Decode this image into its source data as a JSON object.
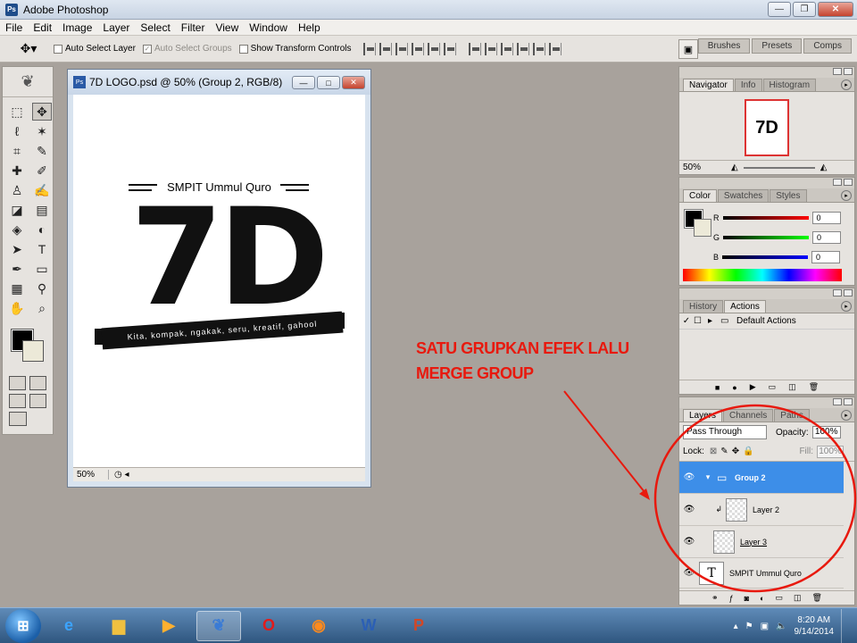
{
  "app": {
    "title": "Adobe Photoshop"
  },
  "menu": [
    "File",
    "Edit",
    "Image",
    "Layer",
    "Select",
    "Filter",
    "View",
    "Window",
    "Help"
  ],
  "options": {
    "auto_select_layer": "Auto Select Layer",
    "auto_select_groups": "Auto Select Groups",
    "show_transform_controls": "Show Transform Controls",
    "panel_tabs": [
      "Brushes",
      "Presets",
      "Comps"
    ]
  },
  "document": {
    "title": "7D LOGO.psd @ 50% (Group 2, RGB/8)",
    "zoom": "50%",
    "artwork": {
      "school": "SMPIT Ummul Quro",
      "logo": "7D",
      "banner": "Kita, kompak, ngakak, seru, kreatif, gahool"
    }
  },
  "navigator": {
    "tabs": [
      "Navigator",
      "Info",
      "Histogram"
    ],
    "zoom": "50%",
    "thumb_text": "7D"
  },
  "color": {
    "tabs": [
      "Color",
      "Swatches",
      "Styles"
    ],
    "channels": [
      {
        "label": "R",
        "value": "0",
        "color": "#cc1111"
      },
      {
        "label": "G",
        "value": "0",
        "color": "#119911"
      },
      {
        "label": "B",
        "value": "0",
        "color": "#1133cc"
      }
    ]
  },
  "history": {
    "tabs": [
      "History",
      "Actions"
    ],
    "items": [
      "Default Actions"
    ]
  },
  "layers": {
    "tabs": [
      "Layers",
      "Channels",
      "Paths"
    ],
    "blend_mode": "Pass Through",
    "opacity_label": "Opacity:",
    "opacity": "100%",
    "lock_label": "Lock:",
    "fill_label": "Fill:",
    "fill": "100%",
    "items": [
      {
        "name": "Group 2",
        "selected": true
      },
      {
        "name": "Layer 2",
        "selected": false
      },
      {
        "name": "Layer 3",
        "selected": false
      },
      {
        "name": "SMPIT Ummul Quro",
        "selected": false
      }
    ]
  },
  "annotation": {
    "line1": "SATU GRUPKAN EFEK LALU",
    "line2": "MERGE GROUP",
    "color": "#e8190e"
  },
  "taskbar": {
    "time": "8:20 AM",
    "date": "9/14/2014"
  }
}
